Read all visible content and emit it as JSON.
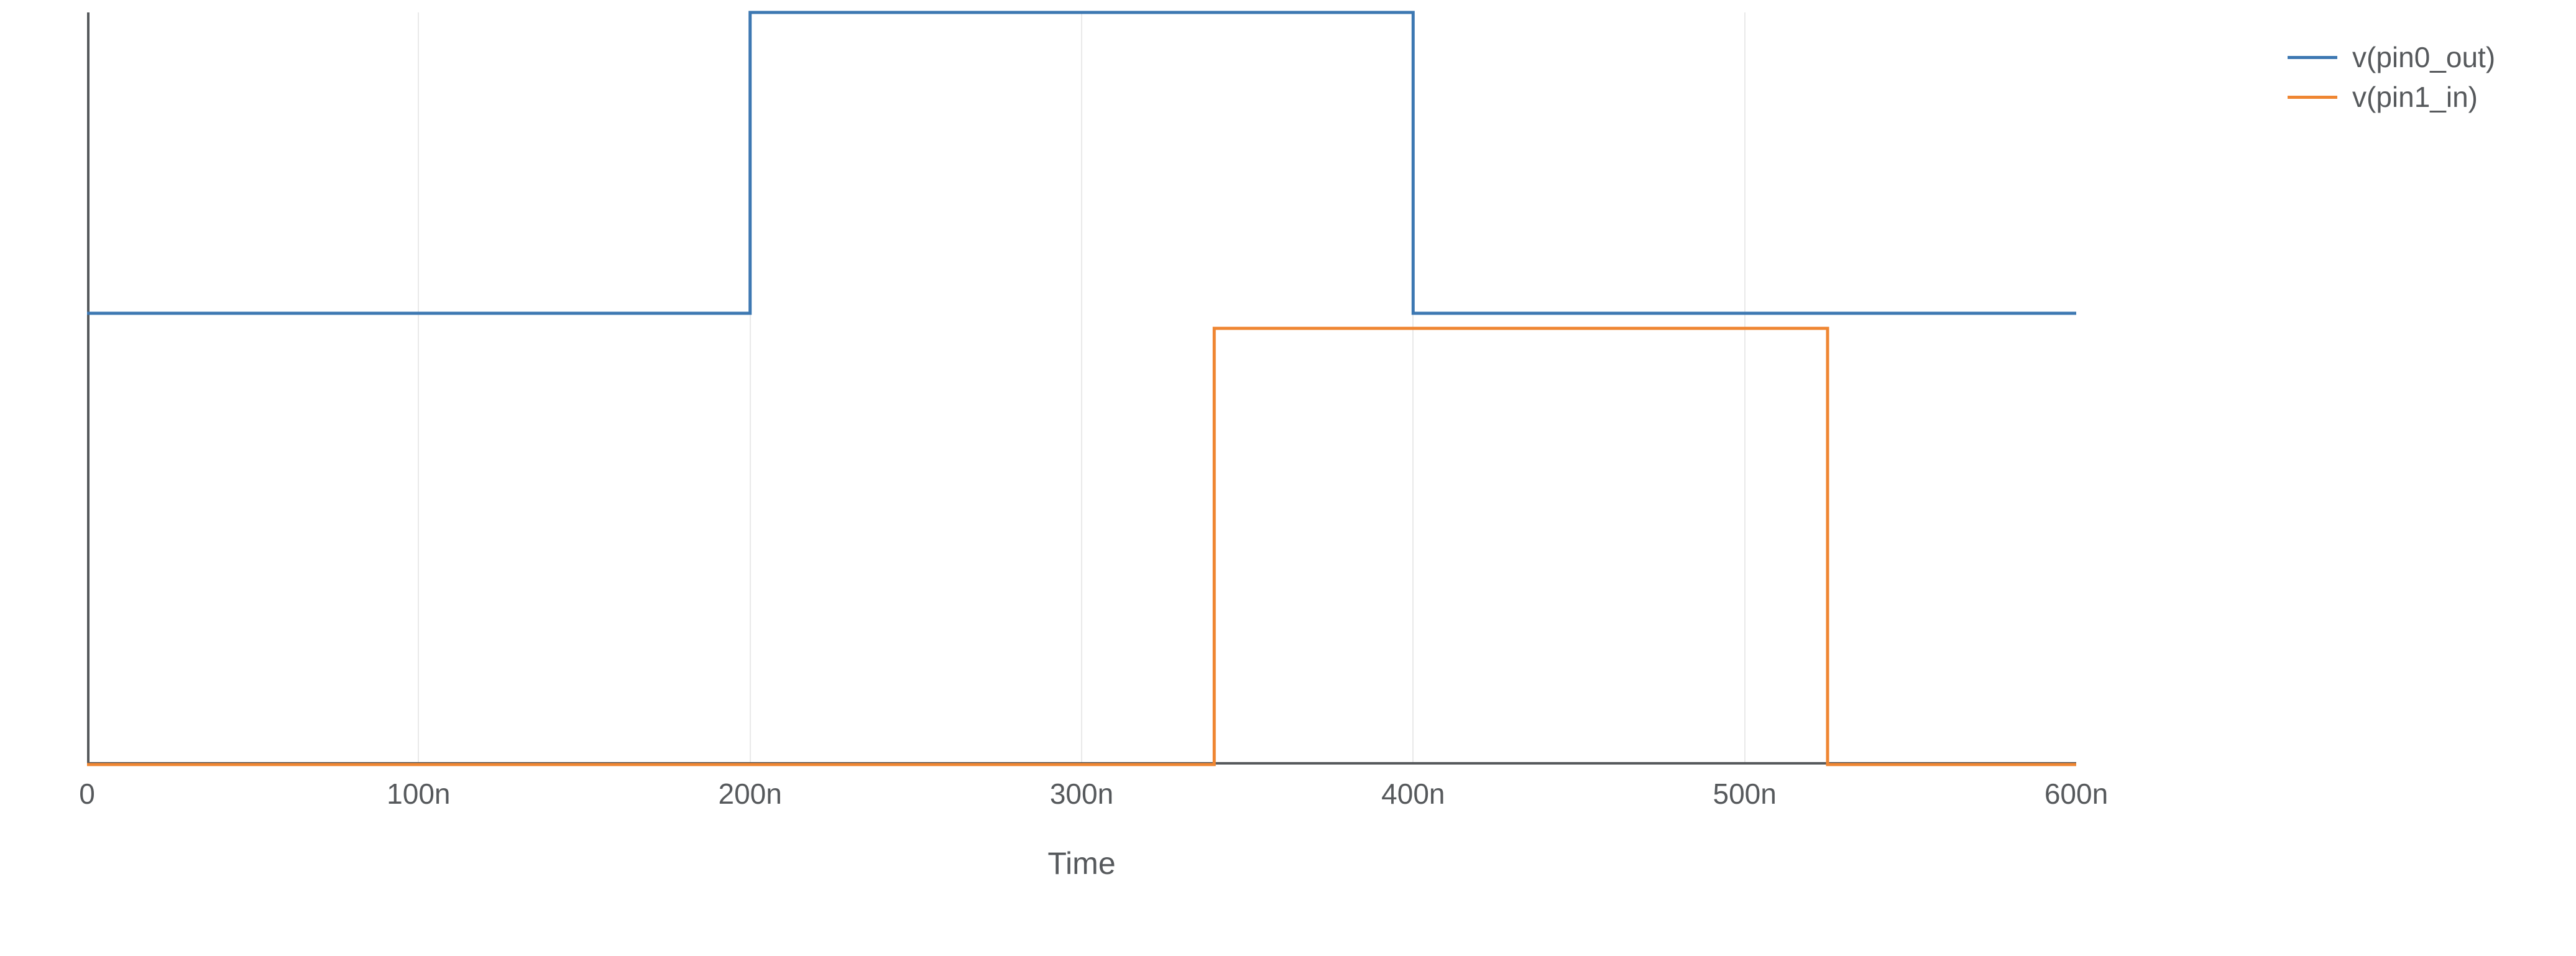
{
  "chart_data": {
    "type": "line",
    "title": "",
    "xlabel": "Time",
    "ylabel": "",
    "xlim": [
      0,
      600
    ],
    "ylim": [
      0,
      2.5
    ],
    "x_ticks": [
      {
        "value": 0,
        "label": "0"
      },
      {
        "value": 100,
        "label": "100n"
      },
      {
        "value": 200,
        "label": "200n"
      },
      {
        "value": 300,
        "label": "300n"
      },
      {
        "value": 400,
        "label": "400n"
      },
      {
        "value": 500,
        "label": "500n"
      },
      {
        "value": 600,
        "label": "600n"
      }
    ],
    "grid_at": [
      100,
      200,
      300,
      400,
      500
    ],
    "series": [
      {
        "name": "v(pin0_out)",
        "color": "#3d78b2",
        "x": [
          0,
          200,
          200,
          400,
          400,
          600
        ],
        "y": [
          1.5,
          1.5,
          2.5,
          2.5,
          1.5,
          1.5
        ]
      },
      {
        "name": "v(pin1_in)",
        "color": "#ef8632",
        "x": [
          0,
          340,
          340,
          525,
          525,
          600
        ],
        "y": [
          0,
          0,
          1.45,
          1.45,
          0,
          0
        ]
      }
    ],
    "legend_position": "right"
  }
}
